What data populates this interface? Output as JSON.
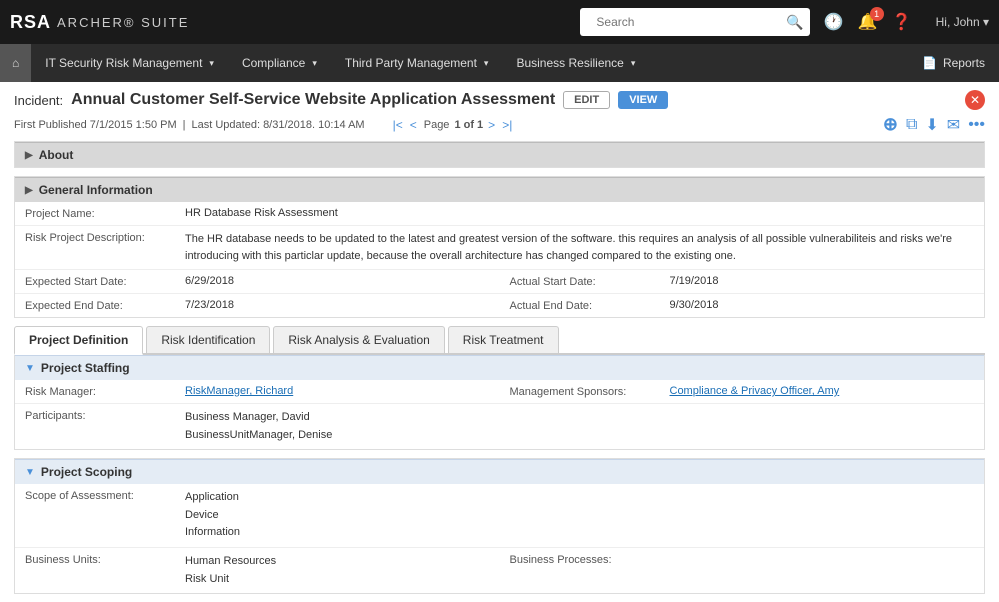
{
  "topnav": {
    "logo": "RSA",
    "suite": "ARCHER® SUITE",
    "search_placeholder": "Search",
    "history_icon": "⏱",
    "bell_icon": "🔔",
    "bell_badge": "1",
    "help_icon": "?",
    "user_label": "Hi, John ▾"
  },
  "secnav": {
    "home_icon": "⌂",
    "items": [
      {
        "label": "IT Security Risk Management",
        "has_arrow": true
      },
      {
        "label": "Compliance",
        "has_arrow": true
      },
      {
        "label": "Third Party Management",
        "has_arrow": true
      },
      {
        "label": "Business Resilience",
        "has_arrow": true
      }
    ],
    "reports_label": "Reports",
    "reports_icon": "📄"
  },
  "incident": {
    "prefix": "Incident:",
    "title": "Annual Customer Self-Service Website Application Assessment",
    "edit_label": "EDIT",
    "view_label": "VIEW",
    "first_published": "First Published 7/1/2015 1:50 PM",
    "last_updated": "Last Updated: 8/31/2018. 10:14 AM",
    "page_label": "Page",
    "page_current": "1 of 1"
  },
  "about_section": {
    "label": "About"
  },
  "general_section": {
    "label": "General Information",
    "project_name_label": "Project Name:",
    "project_name_value": "HR Database Risk Assessment",
    "desc_label": "Risk Project Description:",
    "desc_value": "The HR database needs to be updated to the latest and greatest version of the software. this requires an analysis of all possible vulnerabiliteis and risks we're introducing with this particlar update, because the overall architecture has changed compared to the existing one.",
    "start_label": "Expected Start Date:",
    "start_value": "6/29/2018",
    "end_label": "Expected End Date:",
    "end_value": "7/23/2018",
    "actual_start_label": "Actual Start Date:",
    "actual_start_value": "7/19/2018",
    "actual_end_label": "Actual End Date:",
    "actual_end_value": "9/30/2018"
  },
  "tabs": [
    {
      "label": "Project Definition",
      "active": true
    },
    {
      "label": "Risk Identification",
      "active": false
    },
    {
      "label": "Risk Analysis & Evaluation",
      "active": false
    },
    {
      "label": "Risk Treatment",
      "active": false
    }
  ],
  "staffing_section": {
    "label": "Project Staffing",
    "risk_manager_label": "Risk Manager:",
    "risk_manager_value": "RiskManager, Richard",
    "mgmt_sponsors_label": "Management Sponsors:",
    "mgmt_sponsors_value": "Compliance & Privacy Officer, Amy",
    "participants_label": "Participants:",
    "participant1": "Business Manager, David",
    "participant2": "BusinessUnitManager, Denise"
  },
  "scoping_section": {
    "label": "Project Scoping",
    "scope_label": "Scope of Assessment:",
    "scope1": "Application",
    "scope2": "Device",
    "scope3": "Information",
    "business_units_label": "Business Units:",
    "business_unit1": "Human Resources",
    "business_unit2": "Risk Unit",
    "business_processes_label": "Business Processes:"
  }
}
